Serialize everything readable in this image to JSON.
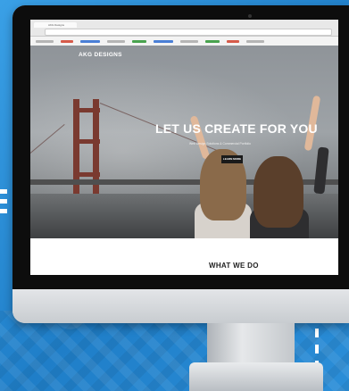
{
  "website": {
    "brand": "AKG DESIGNS",
    "headline": "LET US CREATE FOR YOU",
    "subline": "Web Design Solutions & Commercial Portfolio",
    "cta_label": "LEARN MORE",
    "section_title": "WHAT WE DO"
  },
  "browser": {
    "tab_title": "AKG Designs"
  },
  "colors": {
    "backdrop": "#2a8fd6",
    "bezel": "#0d0d0d",
    "bridge": "#7a3a30"
  }
}
